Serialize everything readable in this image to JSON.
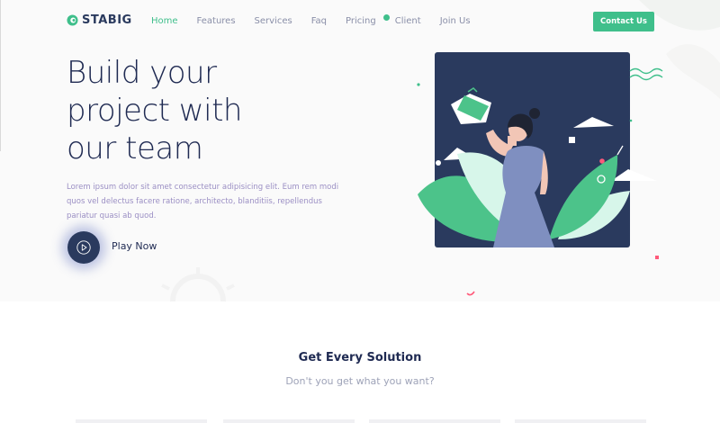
{
  "header": {
    "logo_text": "STABIG",
    "nav": [
      {
        "label": "Home",
        "active": true
      },
      {
        "label": "Features",
        "active": false
      },
      {
        "label": "Services",
        "active": false
      },
      {
        "label": "Faq",
        "active": false
      },
      {
        "label": "Pricing",
        "active": false
      },
      {
        "label": "Client",
        "active": false
      },
      {
        "label": "Join Us",
        "active": false
      }
    ],
    "contact_label": "Contact Us"
  },
  "hero": {
    "title_line1": "Build your",
    "title_line2": "project with",
    "title_line3": "our team",
    "description": "Lorem ipsum dolor sit amet consectetur adipisicing elit. Eum rem modi quos vel delectus facere ratione, architecto, blanditiis, repellendus pariatur quasi ab quod.",
    "play_label": "Play Now"
  },
  "section": {
    "title": "Get Every Solution",
    "subtitle": "Don't you get what you want?"
  },
  "colors": {
    "accent": "#3fbf8b",
    "navy": "#1f2a52",
    "illustration_bg": "#2a3a5e",
    "muted_text": "#9b8fc4"
  }
}
